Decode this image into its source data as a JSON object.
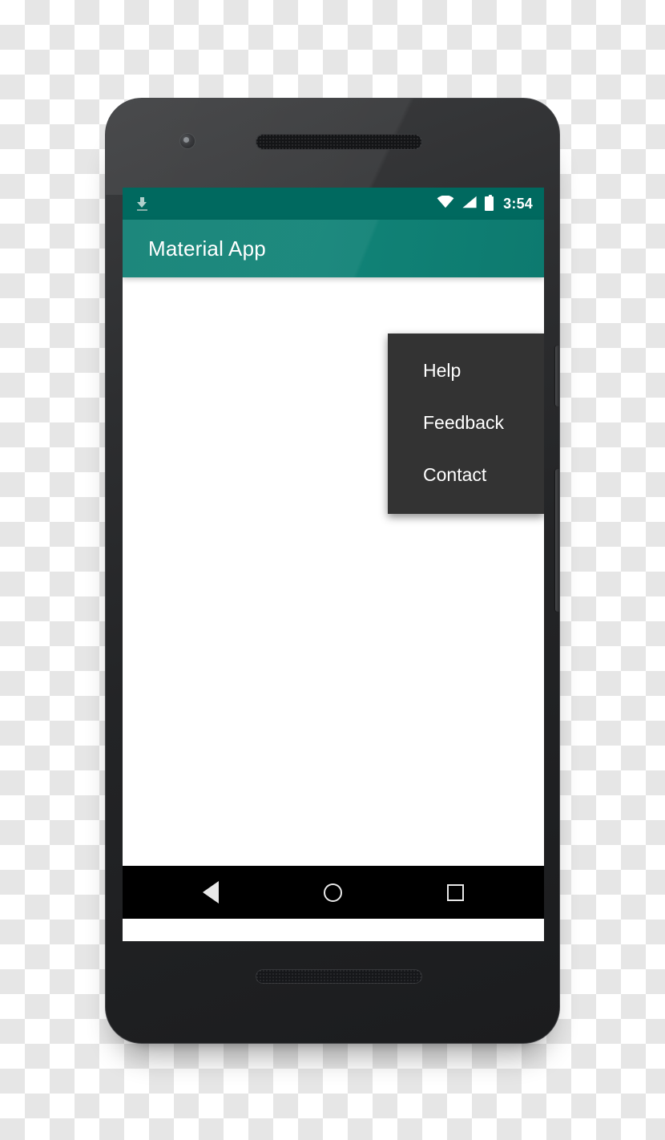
{
  "device": {
    "name": "android-smartphone-mockup",
    "camera_icon": "front-camera-icon",
    "earpiece_icon": "earpiece-speaker-grille",
    "bottom_speaker_icon": "bottom-speaker-grille",
    "power_button_label": "power-button",
    "volume_button_label": "volume-rocker-button"
  },
  "status_bar": {
    "background_color": "#00695f",
    "left_icons": [
      {
        "name": "download-icon",
        "glyph": "download"
      }
    ],
    "right_icons": [
      {
        "name": "wifi-icon",
        "glyph": "wifi"
      },
      {
        "name": "cellular-signal-icon",
        "glyph": "signal"
      },
      {
        "name": "battery-icon",
        "glyph": "battery-full"
      }
    ],
    "time": "3:54"
  },
  "app_bar": {
    "title": "Material App",
    "background_color": "#118377",
    "title_color": "#ffffff"
  },
  "overflow_menu": {
    "background_color": "#333333",
    "text_color": "#ffffff",
    "items": [
      {
        "label": "Help"
      },
      {
        "label": "Feedback"
      },
      {
        "label": "Contact"
      }
    ]
  },
  "content": {
    "background_color": "#ffffff",
    "body_text": ""
  },
  "nav_bar": {
    "background_color": "#000000",
    "buttons": [
      {
        "name": "back-button",
        "glyph": "triangle-left"
      },
      {
        "name": "home-button",
        "glyph": "circle"
      },
      {
        "name": "recents-button",
        "glyph": "square"
      }
    ]
  }
}
